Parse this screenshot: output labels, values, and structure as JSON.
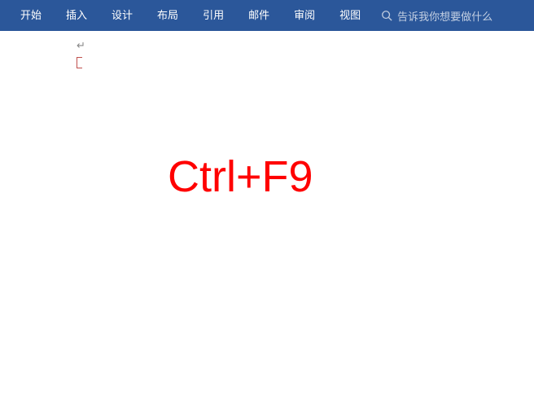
{
  "ribbon": {
    "tabs": [
      {
        "label": "开始"
      },
      {
        "label": "插入"
      },
      {
        "label": "设计"
      },
      {
        "label": "布局"
      },
      {
        "label": "引用"
      },
      {
        "label": "邮件"
      },
      {
        "label": "审阅"
      },
      {
        "label": "视图"
      }
    ],
    "tell_me_placeholder": "告诉我你想要做什么"
  },
  "document": {
    "paragraph_mark": "↵"
  },
  "overlay": {
    "shortcut": "Ctrl+F9"
  }
}
